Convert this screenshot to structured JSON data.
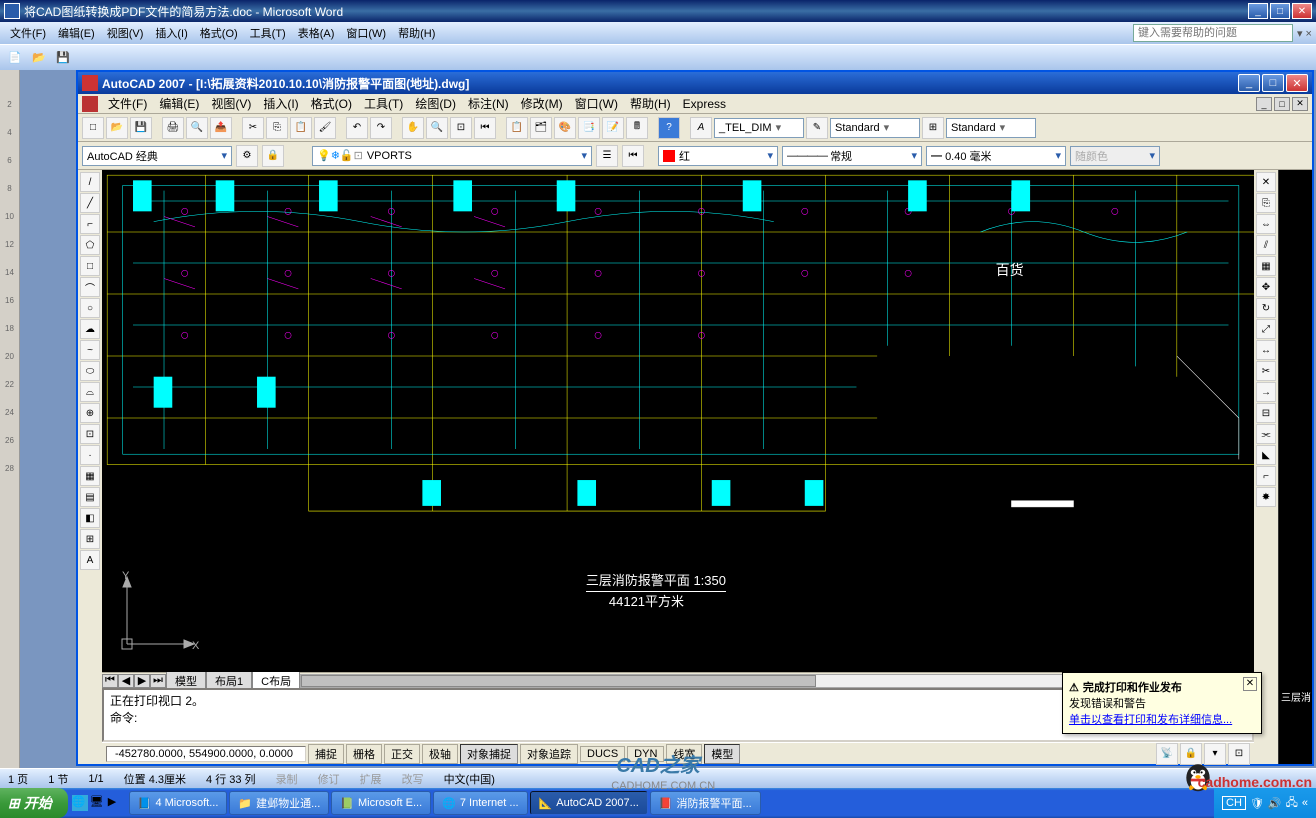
{
  "word": {
    "title": "将CAD图纸转换成PDF文件的简易方法.doc - Microsoft Word",
    "menus": [
      "文件(F)",
      "编辑(E)",
      "视图(V)",
      "插入(I)",
      "格式(O)",
      "工具(T)",
      "表格(A)",
      "窗口(W)",
      "帮助(H)"
    ],
    "help_placeholder": "键入需要帮助的问题",
    "ruler_marks": [
      "2",
      "",
      "4",
      "",
      "6",
      "",
      "8",
      "",
      "10",
      "",
      "12",
      "",
      "14",
      "",
      "16",
      "",
      "18",
      "",
      "20",
      "",
      "22",
      "",
      "24",
      "",
      "26",
      "",
      "28"
    ],
    "status": {
      "page": "1 页",
      "section": "1 节",
      "pages": "1/1",
      "pos": "位置 4.3厘米",
      "line_col": "4 行   33 列",
      "disabled": [
        "录制",
        "修订",
        "扩展",
        "改写"
      ],
      "lang": "中文(中国)"
    }
  },
  "cad": {
    "title": "AutoCAD 2007 - [I:\\拓展资料2010.10.10\\消防报警平面图(地址).dwg]",
    "menus": [
      "文件(F)",
      "编辑(E)",
      "视图(V)",
      "插入(I)",
      "格式(O)",
      "工具(T)",
      "绘图(D)",
      "标注(N)",
      "修改(M)",
      "窗口(W)",
      "帮助(H)",
      "Express"
    ],
    "workspace": "AutoCAD 经典",
    "layer": "VPORTS",
    "dimstyle": "_TEL_DIM",
    "textstyle1": "Standard",
    "textstyle2": "Standard",
    "color_name": "红",
    "linetype": "常规",
    "lineweight": "0.40 毫米",
    "bycolor": "随颜色",
    "tabs": [
      "模型",
      "布局1",
      "C布局"
    ],
    "drawing_title": "三层消防报警平面 1:350",
    "drawing_area": "44121平方米",
    "annotation": "百货",
    "right_label": "三层消",
    "cmd": {
      "line1": "正在打印视口 2。",
      "line2": "命令:"
    },
    "coords": "-452780.0000, 554900.0000, 0.0000",
    "status_btns": [
      "捕捉",
      "栅格",
      "正交",
      "极轴",
      "对象捕捉",
      "对象追踪",
      "DUCS",
      "DYN",
      "线宽",
      "模型"
    ]
  },
  "notify": {
    "title": "完成打印和作业发布",
    "line1": "发现错误和警告",
    "link": "单击以查看打印和发布详细信息..."
  },
  "watermark": {
    "main": "CAD之家",
    "sub": "CADHOME.COM.CN",
    "logo": "cadhome.com.cn"
  },
  "taskbar": {
    "start": "开始",
    "items": [
      {
        "icon": "#2a5caa",
        "label": "4 Microsoft..."
      },
      {
        "icon": "#e7a030",
        "label": "建邺物业通..."
      },
      {
        "icon": "#2a8a2a",
        "label": "Microsoft E..."
      },
      {
        "icon": "#3a7ad8",
        "label": "7 Internet ..."
      },
      {
        "icon": "#c33",
        "label": "AutoCAD 2007..."
      },
      {
        "icon": "#c33",
        "label": "消防报警平面..."
      }
    ],
    "tray_lang": "CH"
  },
  "icons": {
    "line": "/",
    "rect": "□",
    "circle": "○",
    "arc": "⌒",
    "text": "A",
    "hatch": "▦",
    "point": "·",
    "pline": "⌐",
    "ellipse": "⬭",
    "move": "✥",
    "copy": "⎘",
    "mirror": "⇔",
    "offset": "⫽",
    "rotate": "↻",
    "trim": "✂",
    "extend": "→",
    "fillet": "⌐",
    "array": "▦",
    "erase": "✕"
  }
}
